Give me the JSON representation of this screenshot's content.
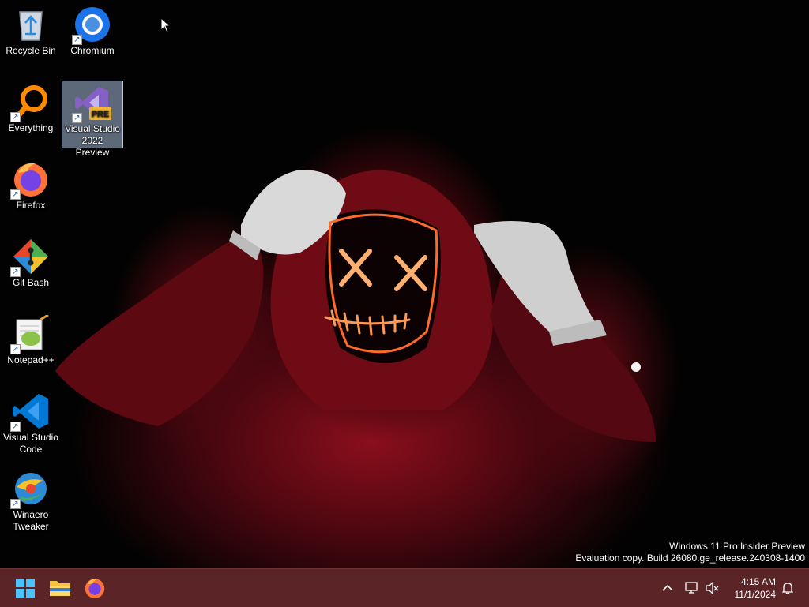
{
  "desktop": {
    "icons": [
      {
        "label": "Recycle Bin",
        "icon": "recycle-bin-icon"
      },
      {
        "label": "Chromium",
        "icon": "chromium-icon"
      },
      {
        "label": "Everything",
        "icon": "everything-search-icon"
      },
      {
        "label": "Visual Studio 2022 Preview",
        "icon": "visual-studio-preview-icon",
        "badge": "PRE"
      },
      {
        "label": "Firefox",
        "icon": "firefox-icon"
      },
      {
        "label": "Git Bash",
        "icon": "git-bash-icon"
      },
      {
        "label": "Notepad++",
        "icon": "notepad-plus-plus-icon"
      },
      {
        "label": "Visual Studio Code",
        "icon": "vscode-icon"
      },
      {
        "label": "Winaero Tweaker",
        "icon": "winaero-tweaker-icon"
      }
    ],
    "watermark": {
      "line1": "Windows 11 Pro Insider Preview",
      "line2": "Evaluation copy. Build 26080.ge_release.240308-1400"
    }
  },
  "taskbar": {
    "apps": [
      {
        "name": "Start",
        "icon": "windows-start-icon"
      },
      {
        "name": "File Explorer",
        "icon": "file-explorer-icon"
      },
      {
        "name": "Firefox",
        "icon": "firefox-icon"
      }
    ],
    "tray": {
      "overflow_icon": "chevron-up-icon",
      "network_icon": "network-icon",
      "volume_icon": "volume-muted-icon",
      "notification_icon": "bell-icon"
    },
    "clock": {
      "time": "4:15 AM",
      "date": "11/1/2024"
    },
    "background": "#5b2427"
  }
}
